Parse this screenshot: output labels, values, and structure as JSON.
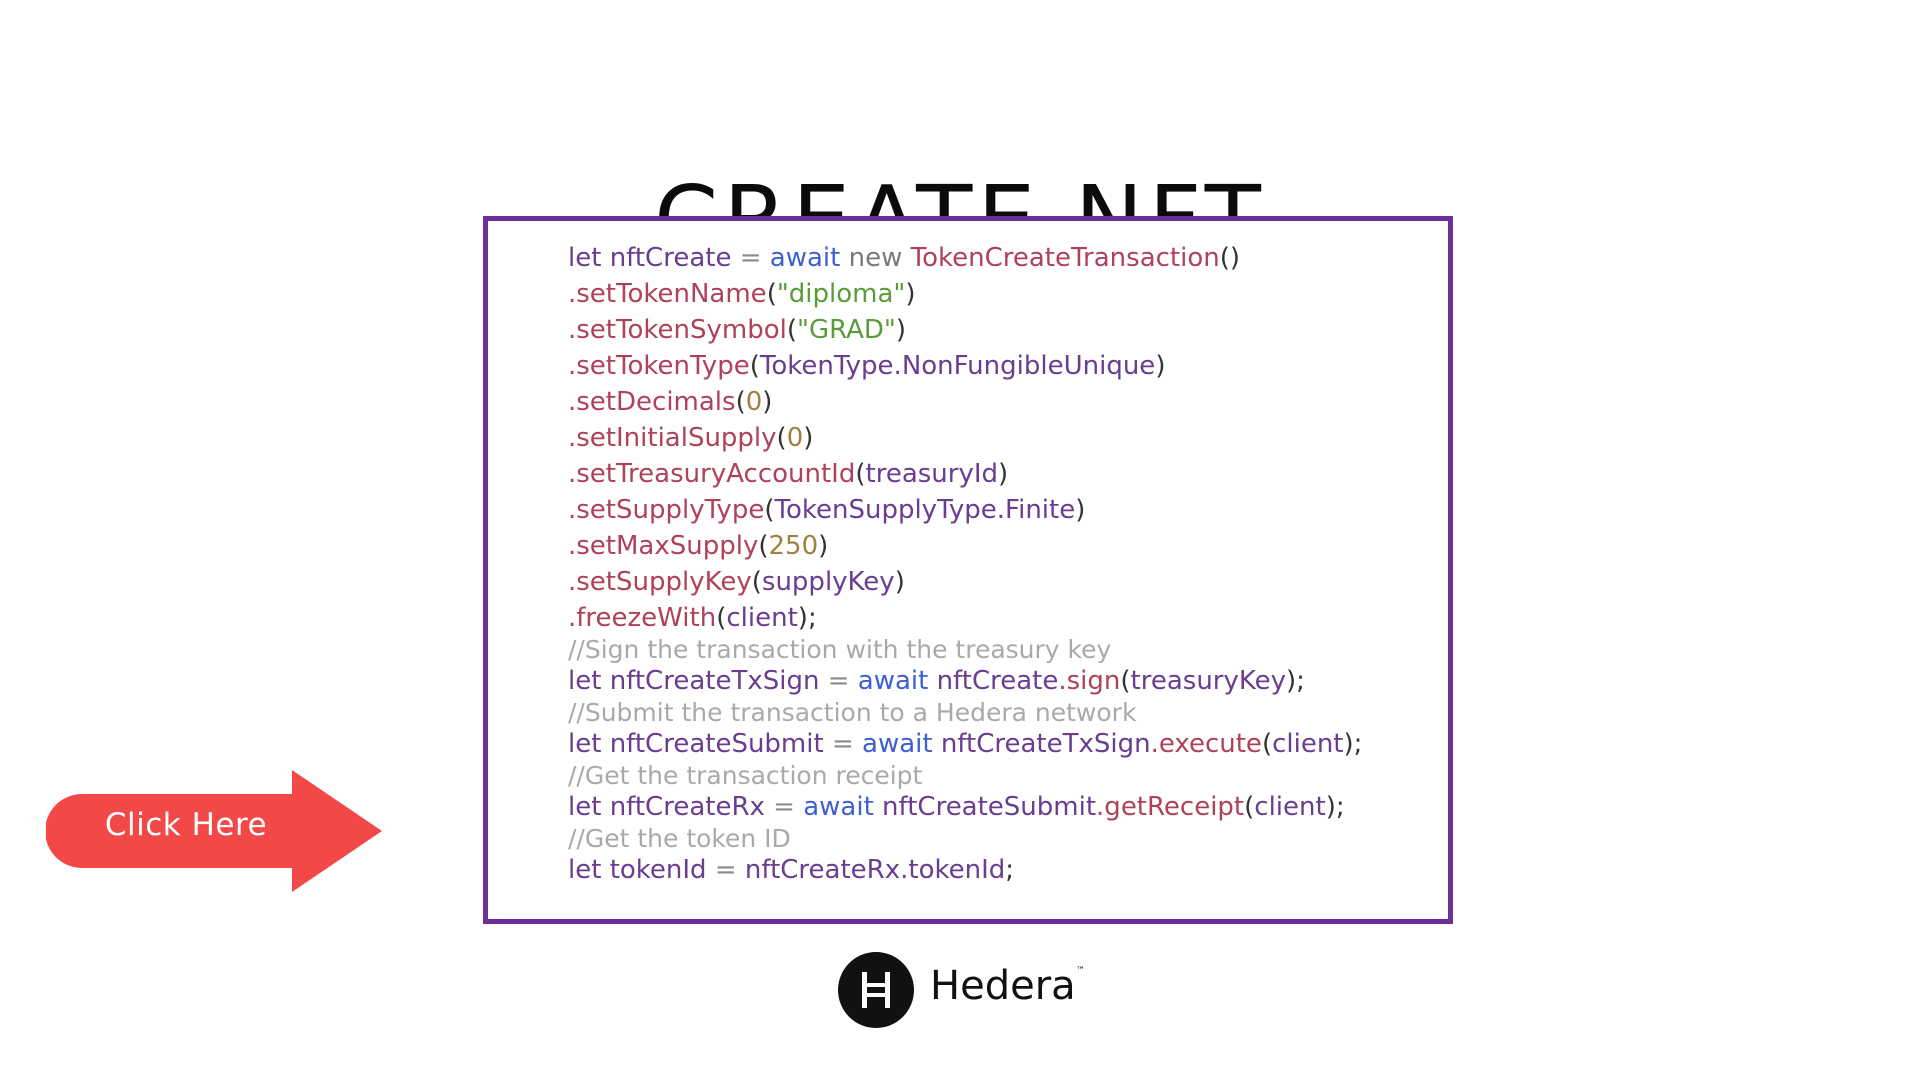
{
  "slide": {
    "title": "CREATE NFT"
  },
  "code": {
    "lines": [
      {
        "type": "code",
        "tokens": [
          {
            "t": "kw",
            "v": "let "
          },
          {
            "t": "ident",
            "v": "nftCreate"
          },
          {
            "t": "op",
            "v": " = "
          },
          {
            "t": "await",
            "v": "await"
          },
          {
            "t": "new",
            "v": " new "
          },
          {
            "t": "class",
            "v": "TokenCreateTransaction"
          },
          {
            "t": "punc",
            "v": "()"
          }
        ]
      },
      {
        "type": "code",
        "tokens": [
          {
            "t": "method",
            "v": ".setTokenName"
          },
          {
            "t": "punc",
            "v": "("
          },
          {
            "t": "str",
            "v": "\"diploma\""
          },
          {
            "t": "punc",
            "v": ")"
          }
        ]
      },
      {
        "type": "code",
        "tokens": [
          {
            "t": "method",
            "v": ".setTokenSymbol"
          },
          {
            "t": "punc",
            "v": "("
          },
          {
            "t": "str",
            "v": "\"GRAD\""
          },
          {
            "t": "punc",
            "v": ")"
          }
        ]
      },
      {
        "type": "code",
        "tokens": [
          {
            "t": "method",
            "v": ".setTokenType"
          },
          {
            "t": "punc",
            "v": "("
          },
          {
            "t": "arg",
            "v": "TokenType.NonFungibleUnique"
          },
          {
            "t": "punc",
            "v": ")"
          }
        ]
      },
      {
        "type": "code",
        "tokens": [
          {
            "t": "method",
            "v": ".setDecimals"
          },
          {
            "t": "punc",
            "v": "("
          },
          {
            "t": "num",
            "v": "0"
          },
          {
            "t": "punc",
            "v": ")"
          }
        ]
      },
      {
        "type": "code",
        "tokens": [
          {
            "t": "method",
            "v": ".setInitialSupply"
          },
          {
            "t": "punc",
            "v": "("
          },
          {
            "t": "num",
            "v": "0"
          },
          {
            "t": "punc",
            "v": ")"
          }
        ]
      },
      {
        "type": "code",
        "tokens": [
          {
            "t": "method",
            "v": ".setTreasuryAccountId"
          },
          {
            "t": "punc",
            "v": "("
          },
          {
            "t": "arg",
            "v": "treasuryId"
          },
          {
            "t": "punc",
            "v": ")"
          }
        ]
      },
      {
        "type": "code",
        "tokens": [
          {
            "t": "method",
            "v": ".setSupplyType"
          },
          {
            "t": "punc",
            "v": "("
          },
          {
            "t": "arg",
            "v": "TokenSupplyType.Finite"
          },
          {
            "t": "punc",
            "v": ")"
          }
        ]
      },
      {
        "type": "code",
        "tokens": [
          {
            "t": "method",
            "v": ".setMaxSupply"
          },
          {
            "t": "punc",
            "v": "("
          },
          {
            "t": "num",
            "v": "250"
          },
          {
            "t": "punc",
            "v": ")"
          }
        ]
      },
      {
        "type": "code",
        "tokens": [
          {
            "t": "method",
            "v": ".setSupplyKey"
          },
          {
            "t": "punc",
            "v": "("
          },
          {
            "t": "arg",
            "v": "supplyKey"
          },
          {
            "t": "punc",
            "v": ")"
          }
        ]
      },
      {
        "type": "code",
        "tokens": [
          {
            "t": "method",
            "v": ".freezeWith"
          },
          {
            "t": "punc",
            "v": "("
          },
          {
            "t": "arg",
            "v": "client"
          },
          {
            "t": "punc",
            "v": ");"
          }
        ]
      },
      {
        "type": "comment",
        "tokens": [
          {
            "t": "comment",
            "v": "//Sign the transaction with the treasury key"
          }
        ]
      },
      {
        "type": "code",
        "tokens": [
          {
            "t": "kw",
            "v": "let "
          },
          {
            "t": "ident",
            "v": "nftCreateTxSign"
          },
          {
            "t": "op",
            "v": " = "
          },
          {
            "t": "await",
            "v": "await "
          },
          {
            "t": "ident",
            "v": "nftCreate"
          },
          {
            "t": "method",
            "v": ".sign"
          },
          {
            "t": "punc",
            "v": "("
          },
          {
            "t": "arg",
            "v": "treasuryKey"
          },
          {
            "t": "punc",
            "v": ");"
          }
        ]
      },
      {
        "type": "comment",
        "tokens": [
          {
            "t": "comment",
            "v": "//Submit the transaction to a Hedera network"
          }
        ]
      },
      {
        "type": "code",
        "tokens": [
          {
            "t": "kw",
            "v": "let "
          },
          {
            "t": "ident",
            "v": "nftCreateSubmit"
          },
          {
            "t": "op",
            "v": " = "
          },
          {
            "t": "await",
            "v": "await "
          },
          {
            "t": "ident",
            "v": "nftCreateTxSign"
          },
          {
            "t": "method",
            "v": ".execute"
          },
          {
            "t": "punc",
            "v": "("
          },
          {
            "t": "arg",
            "v": "client"
          },
          {
            "t": "punc",
            "v": ");"
          }
        ]
      },
      {
        "type": "comment",
        "tokens": [
          {
            "t": "comment",
            "v": "//Get the transaction receipt"
          }
        ]
      },
      {
        "type": "code",
        "tokens": [
          {
            "t": "kw",
            "v": "let "
          },
          {
            "t": "ident",
            "v": "nftCreateRx"
          },
          {
            "t": "op",
            "v": " = "
          },
          {
            "t": "await",
            "v": "await "
          },
          {
            "t": "ident",
            "v": "nftCreateSubmit"
          },
          {
            "t": "method",
            "v": ".getReceipt"
          },
          {
            "t": "punc",
            "v": "("
          },
          {
            "t": "arg",
            "v": "client"
          },
          {
            "t": "punc",
            "v": ");"
          }
        ]
      },
      {
        "type": "comment",
        "tokens": [
          {
            "t": "comment",
            "v": "//Get the token ID"
          }
        ]
      },
      {
        "type": "code",
        "tokens": [
          {
            "t": "kw",
            "v": "let "
          },
          {
            "t": "ident",
            "v": "tokenId"
          },
          {
            "t": "op",
            "v": " = "
          },
          {
            "t": "ident",
            "v": "nftCreateRx.tokenId"
          },
          {
            "t": "punc",
            "v": ";"
          }
        ]
      }
    ]
  },
  "cta": {
    "label": "Click Here",
    "color": "#f24848",
    "icon": "arrow-right-icon"
  },
  "logo": {
    "icon": "hedera-h-icon",
    "name": "Hedera",
    "trademark": "™"
  },
  "colors": {
    "border": "#6b2f9a",
    "title": "#0b0b0b"
  }
}
